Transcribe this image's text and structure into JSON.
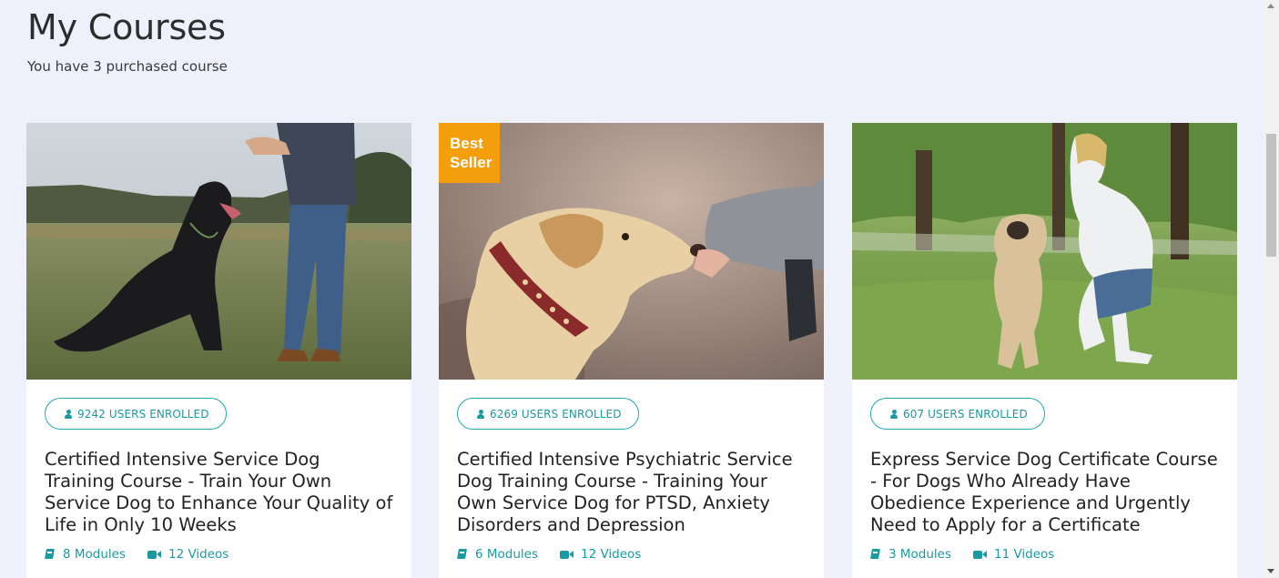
{
  "page": {
    "title": "My Courses",
    "subtitle": "You have 3 purchased course"
  },
  "courses": [
    {
      "image": "rottweiler-training-photo",
      "badge": "",
      "enrolled": "9242 USERS ENROLLED",
      "title": "Certified Intensive Service Dog Training Course - Train Your Own Service Dog to Enhance Your Quality of Life in Only 10 Weeks",
      "modules": "8 Modules",
      "videos": "12 Videos"
    },
    {
      "image": "labrador-treat-photo",
      "badge": "Best Seller",
      "enrolled": "6269 USERS ENROLLED",
      "title": "Certified Intensive Psychiatric Service Dog Training Course - Training Your Own Service Dog for PTSD, Anxiety Disorders and Depression",
      "modules": "6 Modules",
      "videos": "12 Videos"
    },
    {
      "image": "pug-park-photo",
      "badge": "",
      "enrolled": "607 USERS ENROLLED",
      "title": "Express Service Dog Certificate Course - For Dogs Who Already Have Obedience Experience and Urgently Need to Apply for a Certificate",
      "modules": "3 Modules",
      "videos": "11 Videos"
    }
  ],
  "colors": {
    "background": "#eef0fb",
    "accent": "#1a9aa1",
    "badge": "#f59e0b"
  }
}
